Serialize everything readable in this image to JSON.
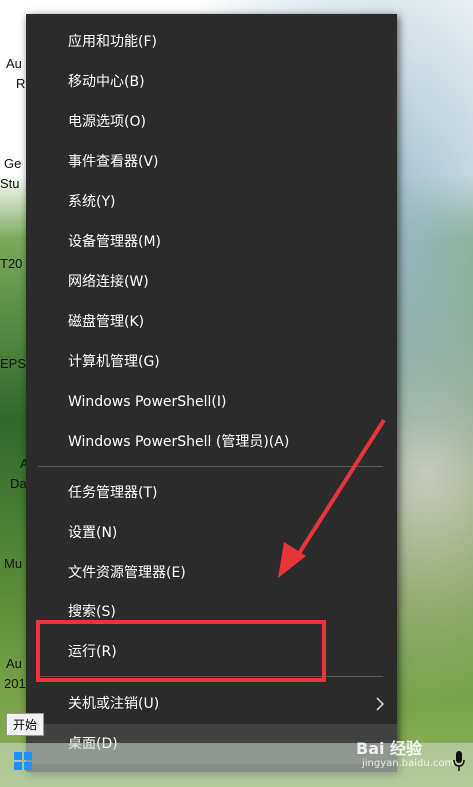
{
  "desktop": {
    "labels": [
      "Au",
      "R",
      "Ge",
      "Stu",
      "T20",
      "EPS",
      "A",
      "Da",
      "Mu",
      "Au",
      "201"
    ]
  },
  "menu": {
    "items": [
      {
        "label": "应用和功能(F)"
      },
      {
        "label": "移动中心(B)"
      },
      {
        "label": "电源选项(O)"
      },
      {
        "label": "事件查看器(V)"
      },
      {
        "label": "系统(Y)"
      },
      {
        "label": "设备管理器(M)"
      },
      {
        "label": "网络连接(W)"
      },
      {
        "label": "磁盘管理(K)"
      },
      {
        "label": "计算机管理(G)"
      },
      {
        "label": "Windows PowerShell(I)"
      },
      {
        "label": "Windows PowerShell (管理员)(A)"
      },
      {
        "label": "任务管理器(T)"
      },
      {
        "label": "设置(N)"
      },
      {
        "label": "文件资源管理器(E)"
      },
      {
        "label": "搜索(S)"
      },
      {
        "label": "运行(R)"
      },
      {
        "label": "关机或注销(U)"
      },
      {
        "label": "桌面(D)"
      }
    ]
  },
  "tooltip": {
    "text": "开始"
  },
  "watermark": {
    "brand": "Bai 经验",
    "sub": "jingyan.baidu.com"
  },
  "annotation": {
    "color": "#e8343a"
  }
}
